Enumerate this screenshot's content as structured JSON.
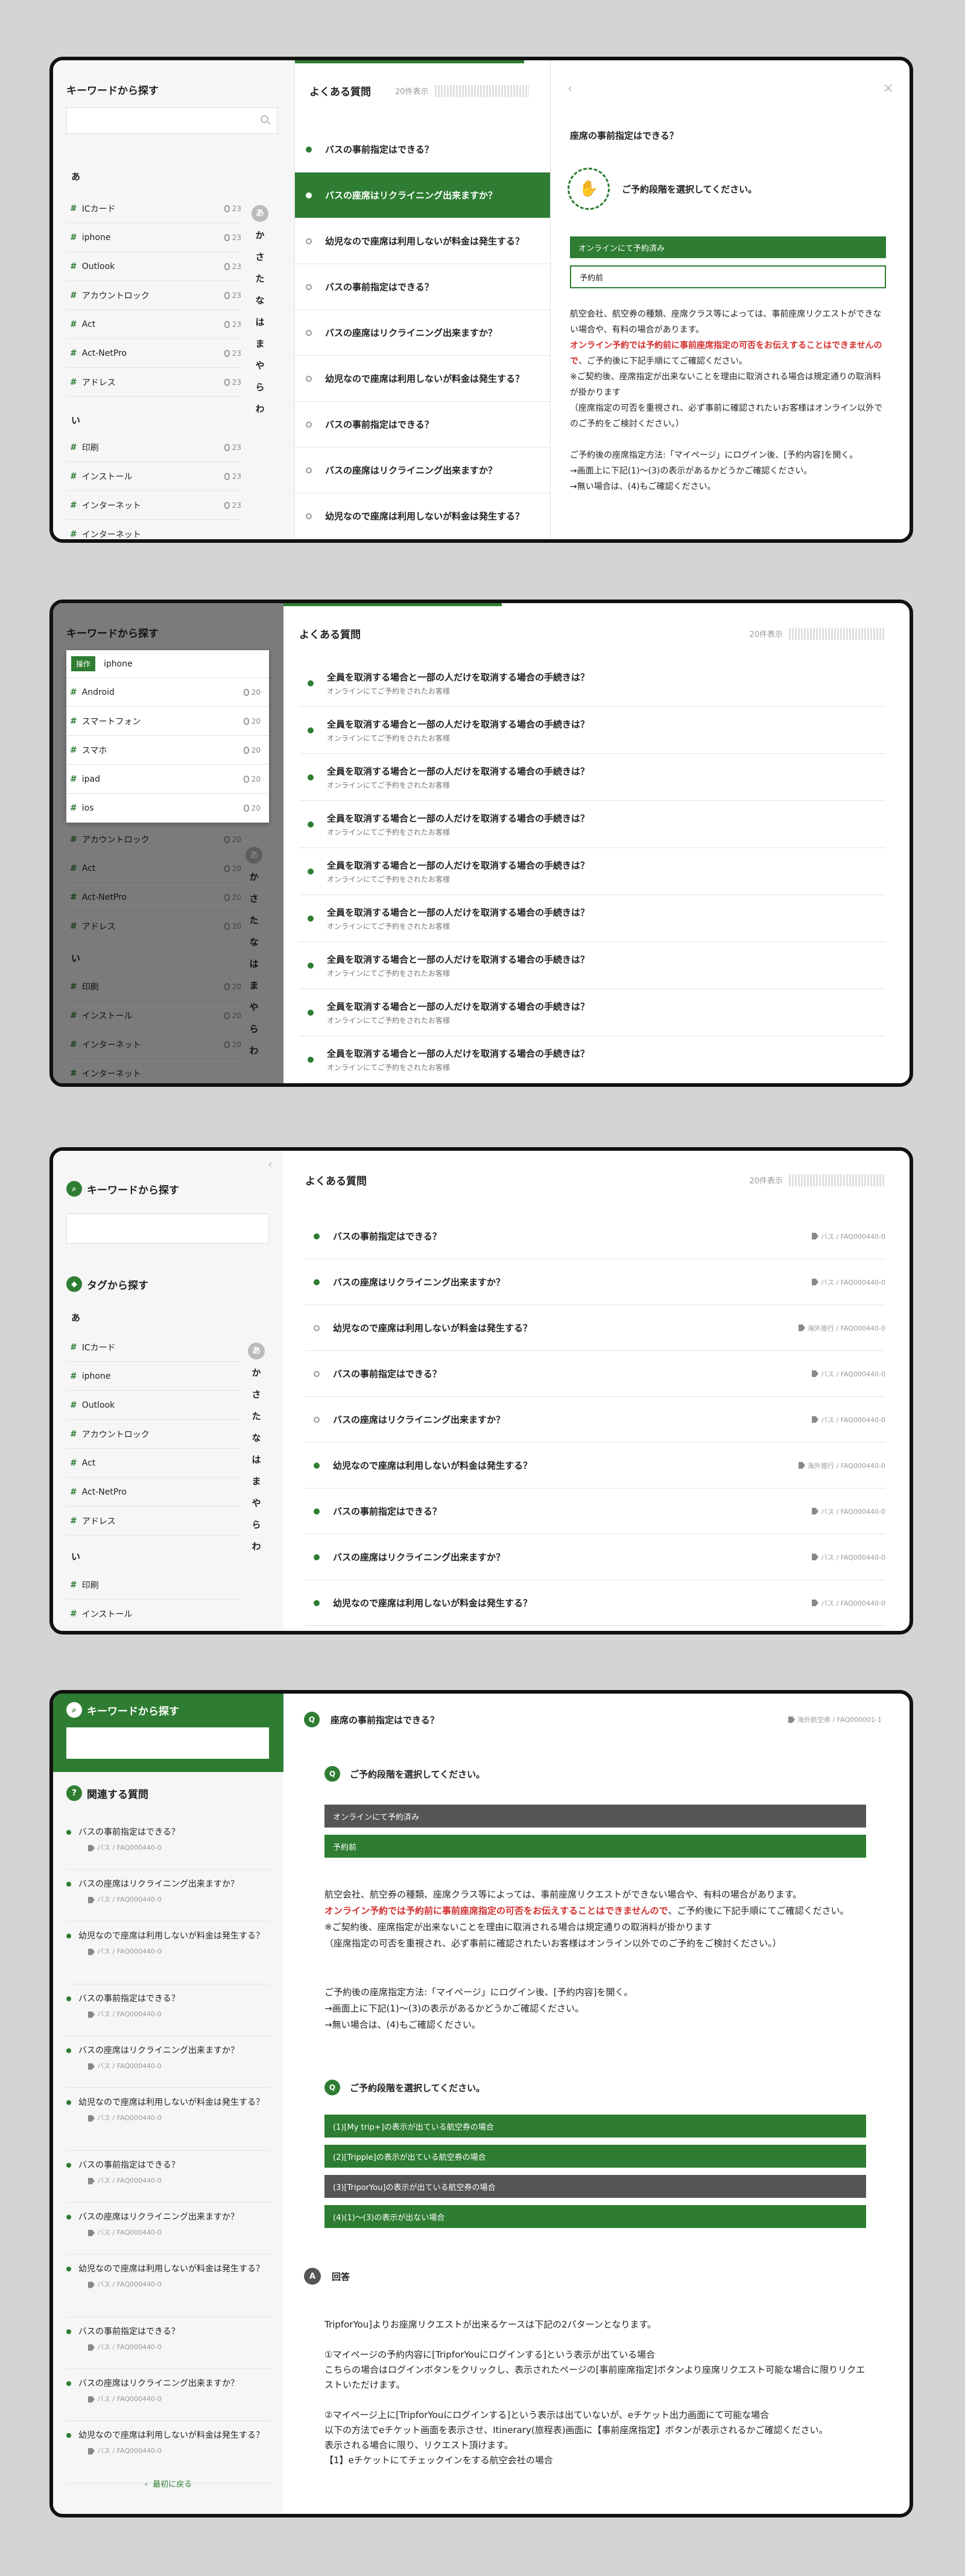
{
  "common": {
    "keyword_title": "キーワードから探す",
    "tag_title": "タグから探す",
    "faq_title": "よくある質問",
    "count": "20件表示",
    "kana_a": "あ",
    "kana_i": "い",
    "kana": [
      "あ",
      "か",
      "さ",
      "た",
      "な",
      "は",
      "ま",
      "や",
      "ら",
      "わ"
    ]
  },
  "panel1": {
    "tags": [
      {
        "name": "ICカード",
        "n": "23"
      },
      {
        "name": "iphone",
        "n": "23"
      },
      {
        "name": "Outlook",
        "n": "23"
      },
      {
        "name": "アカウントロック",
        "n": "23"
      },
      {
        "name": "Act",
        "n": "23"
      },
      {
        "name": "Act-NetPro",
        "n": "23"
      },
      {
        "name": "アドレス",
        "n": "23"
      }
    ],
    "tags2": [
      {
        "name": "印刷",
        "n": "23"
      },
      {
        "name": "インストール",
        "n": "23"
      },
      {
        "name": "インターネット",
        "n": "23"
      },
      {
        "name": "インターネット",
        "n": ""
      }
    ],
    "questions": [
      "バスの事前指定はできる？",
      "バスの座席はリクライニング出来ますか？",
      "幼児なので座席は利用しないが料金は発生する？",
      "バスの事前指定はできる？",
      "バスの座席はリクライニング出来ますか？",
      "幼児なので座席は利用しないが料金は発生する？",
      "バスの事前指定はできる？",
      "バスの座席はリクライニング出来ますか？",
      "幼児なので座席は利用しないが料金は発生する？"
    ],
    "detail": {
      "title": "座席の事前指定はできる？",
      "choose": "ご予約段階を選択してください。",
      "btn1": "オンラインにて予約済み",
      "btn2": "予約前",
      "p1": "航空会社、航空券の種類、座席クラス等によっては、事前座席リクエストができない場合や、有料の場合があります。",
      "p1red": "オンライン予約では予約前に事前座席指定の可否をお伝えすることはできませんので",
      "p1b": "、ご予約後に下記手順にてご確認ください。",
      "p2": "※ご契約後、座席指定が出来ないことを理由に取消される場合は規定通りの取消料が掛かります",
      "p3": "（座席指定の可否を重視され、必ず事前に確認されたいお客様はオンライン以外でのご予約をご検討ください。）",
      "p4": "ご予約後の座席指定方法:「マイページ」にログイン後、[予約内容]を開く。",
      "p5": "→画面上に下記(1)〜(3)の表示があるかどうかご確認ください。",
      "p6": "→無い場合は、(4)もご確認ください。"
    }
  },
  "panel2": {
    "dropdown_label": "操作",
    "dropdown_value": "iphone",
    "dropdown_items": [
      {
        "name": "Android",
        "n": "20"
      },
      {
        "name": "スマートフォン",
        "n": "20"
      },
      {
        "name": "スマホ",
        "n": "20"
      },
      {
        "name": "ipad",
        "n": "20"
      },
      {
        "name": "ios",
        "n": "20"
      }
    ],
    "tags": [
      {
        "name": "アカウントロック",
        "n": "20"
      },
      {
        "name": "Act",
        "n": "20"
      },
      {
        "name": "Act-NetPro",
        "n": "20"
      },
      {
        "name": "アドレス",
        "n": "20"
      }
    ],
    "tags2": [
      {
        "name": "印刷",
        "n": "20"
      },
      {
        "name": "インストール",
        "n": "20"
      },
      {
        "name": "インターネット",
        "n": "20"
      },
      {
        "name": "インターネット",
        "n": ""
      }
    ],
    "q": "全員を取消する場合と一部の人だけを取消する場合の手続きは？",
    "sub": "オンラインにてご予約をされたお客様"
  },
  "panel3": {
    "tags": [
      "ICカード",
      "iphone",
      "Outlook",
      "アカウントロック",
      "Act",
      "Act-NetPro",
      "アドレス"
    ],
    "tags2": [
      "印刷",
      "インストール"
    ],
    "questions": [
      {
        "q": "バスの事前指定はできる？",
        "m": "バス / FAQ000440-0"
      },
      {
        "q": "バスの座席はリクライニング出来ますか？",
        "m": "バス / FAQ000440-0"
      },
      {
        "q": "幼児なので座席は利用しないが料金は発生する？",
        "m": "海外旅行 / FAQ000440-0"
      },
      {
        "q": "バスの事前指定はできる？",
        "m": "バス / FAQ000440-0"
      },
      {
        "q": "バスの座席はリクライニング出来ますか？",
        "m": "バス / FAQ000440-0"
      },
      {
        "q": "幼児なので座席は利用しないが料金は発生する？",
        "m": "海外旅行 / FAQ000440-0"
      },
      {
        "q": "バスの事前指定はできる？",
        "m": "バス / FAQ000440-0"
      },
      {
        "q": "バスの座席はリクライニング出来ますか？",
        "m": "バス / FAQ000440-0"
      },
      {
        "q": "幼児なので座席は利用しないが料金は発生する？",
        "m": "バス / FAQ000440-0"
      }
    ]
  },
  "panel4": {
    "related_title": "関連する質問",
    "related": [
      {
        "q": "バスの事前指定はできる？",
        "m": "バス / FAQ000440-0"
      },
      {
        "q": "バスの座席はリクライニング出来ますか？",
        "m": "バス / FAQ000440-0"
      },
      {
        "q": "幼児なので座席は利用しないが料金は発生する？",
        "m": "バス / FAQ000440-0"
      },
      {
        "q": "バスの事前指定はできる？",
        "m": "バス / FAQ000440-0"
      },
      {
        "q": "バスの座席はリクライニング出来ますか？",
        "m": "バス / FAQ000440-0"
      },
      {
        "q": "幼児なので座席は利用しないが料金は発生する？",
        "m": "バス / FAQ000440-0"
      },
      {
        "q": "バスの事前指定はできる？",
        "m": "バス / FAQ000440-0"
      },
      {
        "q": "バスの座席はリクライニング出来ますか？",
        "m": "バス / FAQ000440-0"
      },
      {
        "q": "幼児なので座席は利用しないが料金は発生する？",
        "m": "バス / FAQ000440-0"
      },
      {
        "q": "バスの事前指定はできる？",
        "m": "バス / FAQ000440-0"
      },
      {
        "q": "バスの座席はリクライニング出来ますか？",
        "m": "バス / FAQ000440-0"
      },
      {
        "q": "幼児なので座席は利用しないが料金は発生する？",
        "m": "バス / FAQ000440-0"
      }
    ],
    "back": "最初に戻る",
    "q_title": "座席の事前指定はできる？",
    "q_meta": "海外航空券 / FAQ000001-1",
    "q_badge": "Q",
    "a_badge": "A",
    "choose": "ご予約段階を選択してください。",
    "btn1": "オンラインにて予約済み",
    "btn2": "予約前",
    "p1": "航空会社、航空券の種類、座席クラス等によっては、事前座席リクエストができない場合や、有料の場合があります。",
    "p1red": "オンライン予約では予約前に事前座席指定の可否をお伝えすることはできませんので",
    "p1b": "、ご予約後に下記手順にてご確認ください。",
    "p2": "※ご契約後、座席指定が出来ないことを理由に取消される場合は規定通りの取消料が掛かります",
    "p3": "（座席指定の可否を重視され、必ず事前に確認されたいお客様はオンライン以外でのご予約をご検討ください。）",
    "p4": "ご予約後の座席指定方法:「マイページ」にログイン後、[予約内容]を開く。",
    "p5": "→画面上に下記(1)〜(3)の表示があるかどうかご確認ください。",
    "p6": "→無い場合は、(4)もご確認ください。",
    "choose2": "ご予約段階を選択してください。",
    "opts": [
      "(1)[My trip+]の表示が出ている航空券の場合",
      "(2)[Tripple]の表示が出ている航空券の場合",
      "(3)[TriporYou]の表示が出ている航空券の場合",
      "(4)(1)〜(3)の表示が出ない場合"
    ],
    "answer_label": "回答",
    "a1": "TripforYou]よりお座席リクエストが出来るケースは下記の2パターンとなります。",
    "a2": "①マイページの予約内容に[TripforYouにログインする]という表示が出ている場合",
    "a3": "こちらの場合はログインボタンをクリックし、表示されたページの[事前座席指定]ボタンより座席リクエスト可能な場合に限りリクエストいただけます。",
    "a4": "②マイページ上に[TripforYouにログインする]という表示は出ていないが、eチケット出力画面にて可能な場合",
    "a5": "以下の方法でeチケット画面を表示させ、Itinerary(旅程表)画面に【事前座席指定】ボタンが表示されるかご確認ください。",
    "a6": "表示される場合に限り、リクエスト頂けます。",
    "a7": "【1】eチケットにてチェックインをする航空会社の場合"
  }
}
